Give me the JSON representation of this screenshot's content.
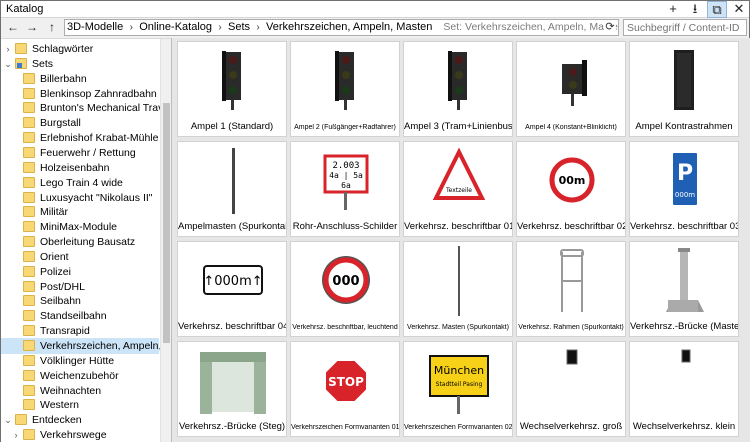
{
  "window": {
    "title": "Katalog",
    "controls": [
      {
        "name": "add-icon",
        "glyph": "+"
      },
      {
        "name": "download-icon",
        "glyph": "⭳"
      },
      {
        "name": "popout-icon",
        "glyph": "⧉"
      },
      {
        "name": "close-icon",
        "glyph": "✕"
      }
    ]
  },
  "nav": {
    "back_glyph": "←",
    "forward_glyph": "→",
    "up_glyph": "↑",
    "breadcrumbs": [
      "3D-Modelle",
      "Online-Katalog",
      "Sets",
      "Verkehrszeichen, Ampeln, Masten"
    ],
    "address_hint": "Set: Verkehrszeichen, Ampeln, Masten",
    "refresh_glyph": "⟳",
    "search_placeholder": "Suchbegriff / Content-ID"
  },
  "sidebar": {
    "items": [
      {
        "label": "Schlagwörter",
        "level": 0,
        "chevron": "›",
        "icon": "folder-tag",
        "selected": false
      },
      {
        "label": "Sets",
        "level": 0,
        "chevron": "⌄",
        "icon": "folder-sets",
        "selected": false
      },
      {
        "label": "Billerbahn",
        "level": 1,
        "selected": false
      },
      {
        "label": "Blenkinsop Zahnradbahn",
        "level": 1,
        "selected": false
      },
      {
        "label": "Brunton's Mechanical Traveller",
        "level": 1,
        "selected": false
      },
      {
        "label": "Burgstall",
        "level": 1,
        "selected": false
      },
      {
        "label": "Erlebnishof Krabat-Mühle",
        "level": 1,
        "selected": false
      },
      {
        "label": "Feuerwehr / Rettung",
        "level": 1,
        "selected": false
      },
      {
        "label": "Holzeisenbahn",
        "level": 1,
        "selected": false
      },
      {
        "label": "Lego Train 4 wide",
        "level": 1,
        "selected": false
      },
      {
        "label": "Luxusyacht \"Nikolaus II\"",
        "level": 1,
        "selected": false
      },
      {
        "label": "Militär",
        "level": 1,
        "selected": false
      },
      {
        "label": "MiniMax-Module",
        "level": 1,
        "selected": false
      },
      {
        "label": "Oberleitung Bausatz",
        "level": 1,
        "selected": false
      },
      {
        "label": "Orient",
        "level": 1,
        "selected": false
      },
      {
        "label": "Polizei",
        "level": 1,
        "selected": false
      },
      {
        "label": "Post/DHL",
        "level": 1,
        "selected": false
      },
      {
        "label": "Seilbahn",
        "level": 1,
        "selected": false
      },
      {
        "label": "Standseilbahn",
        "level": 1,
        "selected": false
      },
      {
        "label": "Transrapid",
        "level": 1,
        "selected": false
      },
      {
        "label": "Verkehrszeichen, Ampeln, Masten",
        "level": 1,
        "selected": true
      },
      {
        "label": "Völklinger Hütte",
        "level": 1,
        "selected": false
      },
      {
        "label": "Weichenzubehör",
        "level": 1,
        "selected": false
      },
      {
        "label": "Weihnachten",
        "level": 1,
        "selected": false
      },
      {
        "label": "Western",
        "level": 1,
        "selected": false
      },
      {
        "label": "Entdecken",
        "level": 0,
        "chevron": "⌄",
        "icon": "folder",
        "selected": false
      },
      {
        "label": "Verkehrswege",
        "level": 1,
        "chevron": "›",
        "selected": false
      }
    ]
  },
  "tiles": [
    {
      "label": "Ampel 1 (Standard)",
      "small": false,
      "thumb": "traffic-light-3"
    },
    {
      "label": "Ampel 2 (Fußgänger+Radfahrer)",
      "small": true,
      "thumb": "traffic-light-3"
    },
    {
      "label": "Ampel 3 (Tram+Linienbus)",
      "small": false,
      "thumb": "traffic-light-3"
    },
    {
      "label": "Ampel 4 (Konstant+Blinklicht)",
      "small": true,
      "thumb": "traffic-light-2"
    },
    {
      "label": "Ampel Kontrastrahmen",
      "small": false,
      "thumb": "contrast-frame"
    },
    {
      "label": "Ampelmasten (Spurkontakt)",
      "small": false,
      "thumb": "pole"
    },
    {
      "label": "Rohr-Anschluss-Schilder",
      "small": false,
      "thumb": "pipe-sign",
      "sign_lines": [
        "2.003",
        "4a | 5a",
        "6a"
      ]
    },
    {
      "label": "Verkehrsz. beschriftbar 01",
      "small": false,
      "thumb": "warning-triangle",
      "sign_text": "Textzeile"
    },
    {
      "label": "Verkehrsz. beschriftbar 02",
      "small": false,
      "thumb": "prohibition-circle",
      "sign_text": "00m"
    },
    {
      "label": "Verkehrsz. beschriftbar 03",
      "small": false,
      "thumb": "parking-sign",
      "sign_text": "P",
      "sign_sub": "000m"
    },
    {
      "label": "Verkehrsz. beschriftbar 04",
      "small": false,
      "thumb": "distance-sign",
      "sign_text": "↑000m↑"
    },
    {
      "label": "Verkehrsz. beschriftbar, leuchtend",
      "small": true,
      "thumb": "illuminated-circle",
      "sign_text": "000"
    },
    {
      "label": "Verkehrsz. Masten (Spurkontakt)",
      "small": true,
      "thumb": "thin-pole"
    },
    {
      "label": "Verkehrsz. Rahmen (Spurkontakt)",
      "small": true,
      "thumb": "frame"
    },
    {
      "label": "Verkehrsz.-Brücke (Masten)",
      "small": false,
      "thumb": "bridge-mast"
    },
    {
      "label": "Verkehrsz.-Brücke (Steg)",
      "small": false,
      "thumb": "bridge-gantry"
    },
    {
      "label": "Verkehrszeichen Formvarianten 01",
      "small": true,
      "thumb": "stop-sign",
      "sign_text": "STOP"
    },
    {
      "label": "Verkehrszeichen Formvarianten 02",
      "small": true,
      "thumb": "town-sign",
      "sign_text": "München",
      "sign_sub": "Stadtteil Pasing"
    },
    {
      "label": "Wechselverkehrsz. groß",
      "small": false,
      "thumb": "vms-large"
    },
    {
      "label": "Wechselverkehrsz. klein",
      "small": false,
      "thumb": "vms-small"
    }
  ],
  "colors": {
    "selection": "#cce4f7",
    "sign_red": "#d8232a",
    "sign_blue": "#1f5fb4",
    "town_yellow": "#f7d117",
    "folder": "#f8d775"
  }
}
